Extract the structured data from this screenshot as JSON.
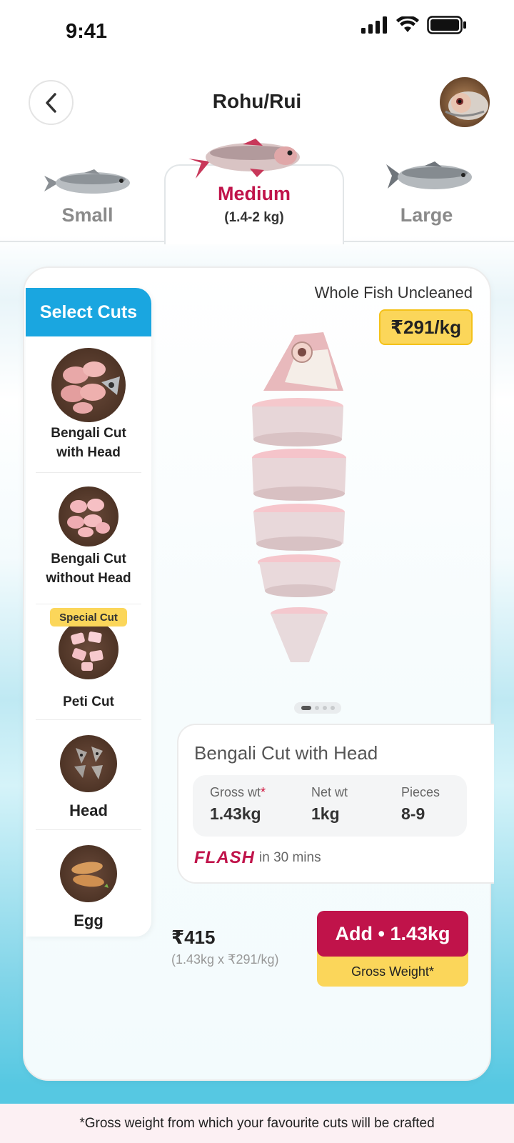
{
  "status_bar": {
    "time": "9:41",
    "icons": [
      "signal-icon",
      "wifi-icon",
      "battery-icon"
    ]
  },
  "header": {
    "title": "Rohu/Rui",
    "back_icon": "chevron-left-icon",
    "avatar_icon": "fish-avatar"
  },
  "size_tabs": {
    "selected": "Medium",
    "items": [
      {
        "label": "Small",
        "sub": ""
      },
      {
        "label": "Medium",
        "sub": "(1.4-2 kg)"
      },
      {
        "label": "Large",
        "sub": ""
      }
    ]
  },
  "cuts": {
    "header": "Select Cuts",
    "items": [
      {
        "label": "Bengali Cut with Head",
        "badge": ""
      },
      {
        "label": "Bengali Cut without Head",
        "badge": ""
      },
      {
        "label": "Peti Cut",
        "badge": "Special Cut"
      },
      {
        "label": "Head",
        "badge": ""
      },
      {
        "label": "Egg",
        "badge": ""
      }
    ]
  },
  "product": {
    "name": "Whole Fish Uncleaned",
    "price_per_kg": "₹291/kg",
    "carousel": {
      "current_page": 1,
      "total_pages": 4
    }
  },
  "cut_details": {
    "title": "Bengali Cut with Head",
    "gross_label": "Gross wt",
    "gross_star": "*",
    "gross_value": "1.43kg",
    "net_label": "Net wt",
    "net_value": "1kg",
    "pieces_label": "Pieces",
    "pieces_value": "8-9",
    "flash_logo": "FLASH",
    "flash_text": "in 30 mins"
  },
  "cart": {
    "total": "₹415",
    "calculation": "(1.43kg x ₹291/kg)",
    "add_label": "Add • 1.43kg",
    "gross_note": "Gross Weight*"
  },
  "footer": {
    "note": "*Gross weight from which your favourite cuts will be crafted"
  },
  "colors": {
    "accent": "#c0134a",
    "cuts_header": "#1aa6e0",
    "price_badge": "#fbd65a"
  }
}
